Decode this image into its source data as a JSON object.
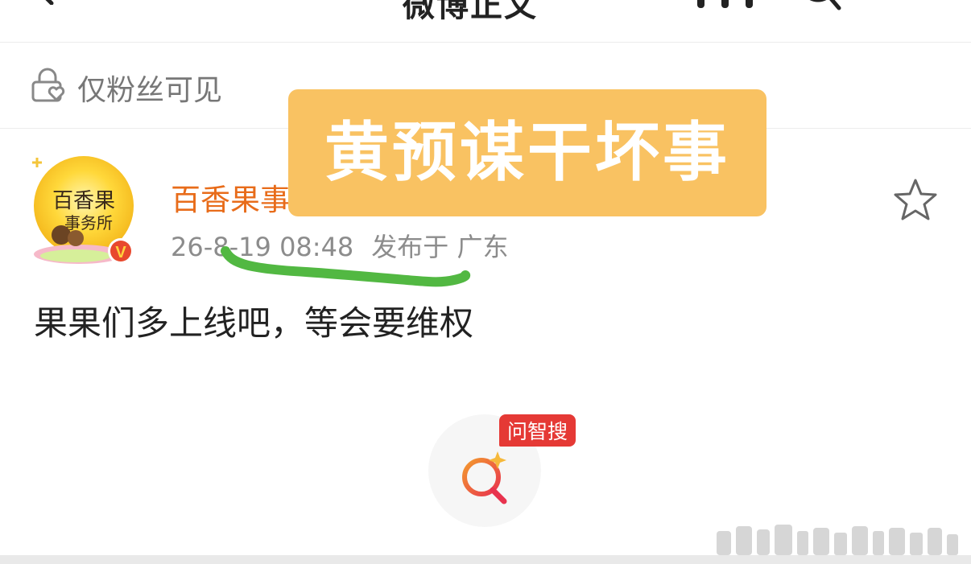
{
  "header": {
    "title": "微博正文"
  },
  "visibility": {
    "label": "仅粉丝可见"
  },
  "author": {
    "name": "百香果事",
    "avatar_text": [
      "百香果",
      "事务所"
    ],
    "verified_badge": "V"
  },
  "post": {
    "timestamp": "26-8-19 08:48",
    "location": "发布于 广东",
    "text": "果果们多上线吧，等会要维权"
  },
  "overlay": {
    "label": "黄预谋干坏事",
    "color": "#f9c262"
  },
  "smart_search": {
    "badge": "问智搜"
  },
  "colors": {
    "author_name": "#e86c1a",
    "meta": "#8c8c8c",
    "underline": "#52b842",
    "badge_bg": "#e53935"
  },
  "icons": {
    "back": "chevron-left-icon",
    "more": "more-icon",
    "search": "search-icon",
    "lock": "lock-heart-icon",
    "favorite": "star-icon",
    "smart_search": "magnifier-sparkle-icon"
  }
}
